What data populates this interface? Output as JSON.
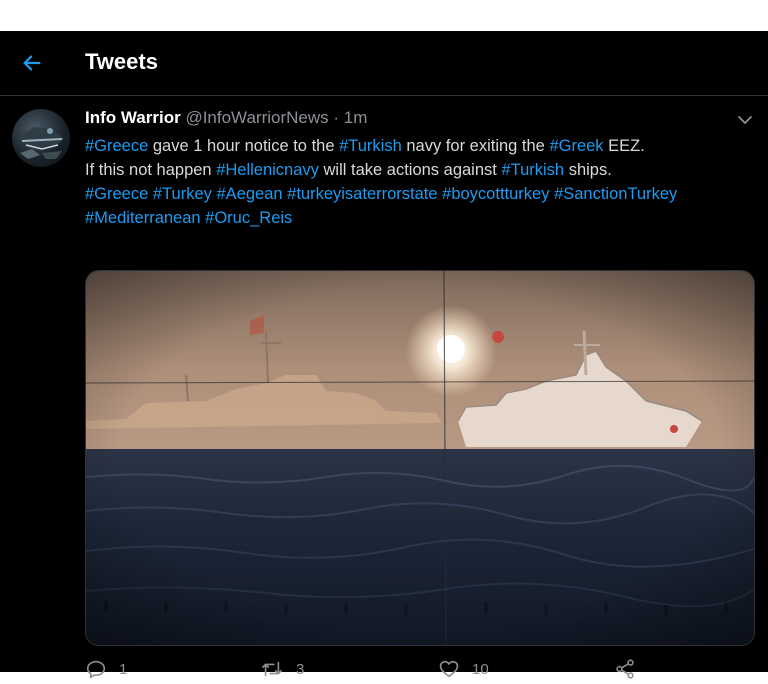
{
  "header": {
    "title": "Tweets"
  },
  "tweet": {
    "author_name": "Info Warrior",
    "author_handle": "@InfoWarriorNews",
    "separator": "·",
    "time": "1m",
    "lines": [
      [
        {
          "t": "#Greece",
          "tag": true
        },
        {
          "t": " gave 1 hour notice to the ",
          "tag": false
        },
        {
          "t": "#Turkish",
          "tag": true
        },
        {
          "t": " navy for exiting the ",
          "tag": false
        },
        {
          "t": "#Greek",
          "tag": true
        },
        {
          "t": " EEZ.",
          "tag": false
        }
      ],
      [
        {
          "t": "If this not happen ",
          "tag": false
        },
        {
          "t": "#Hellenicnavy",
          "tag": true
        },
        {
          "t": " will take actions against ",
          "tag": false
        },
        {
          "t": "#Turkish",
          "tag": true
        },
        {
          "t": " ships.",
          "tag": false
        }
      ],
      [
        {
          "t": "#Greece",
          "tag": true
        },
        {
          "t": " ",
          "tag": false
        },
        {
          "t": "#Turkey",
          "tag": true
        },
        {
          "t": " ",
          "tag": false
        },
        {
          "t": "#Aegean",
          "tag": true
        },
        {
          "t": " ",
          "tag": false
        },
        {
          "t": "#turkeyisaterrorstate",
          "tag": true
        },
        {
          "t": " ",
          "tag": false
        },
        {
          "t": "#boycottturkey",
          "tag": true
        },
        {
          "t": " ",
          "tag": false
        },
        {
          "t": "#SanctionTurkey",
          "tag": true
        }
      ],
      [
        {
          "t": "#Mediterranean",
          "tag": true
        },
        {
          "t": " ",
          "tag": false
        },
        {
          "t": "#Oruc_Reis",
          "tag": true
        }
      ]
    ],
    "stats": {
      "replies": "1",
      "retweets": "3",
      "likes": "10"
    }
  },
  "colors": {
    "background": "#000000",
    "link": "#1d9bf0",
    "muted": "#8b9096",
    "divider": "#2f3336"
  },
  "icons": {
    "back": "arrow-left-icon",
    "caret": "chevron-down-icon",
    "reply": "reply-icon",
    "retweet": "retweet-icon",
    "like": "heart-icon",
    "share": "share-icon"
  }
}
